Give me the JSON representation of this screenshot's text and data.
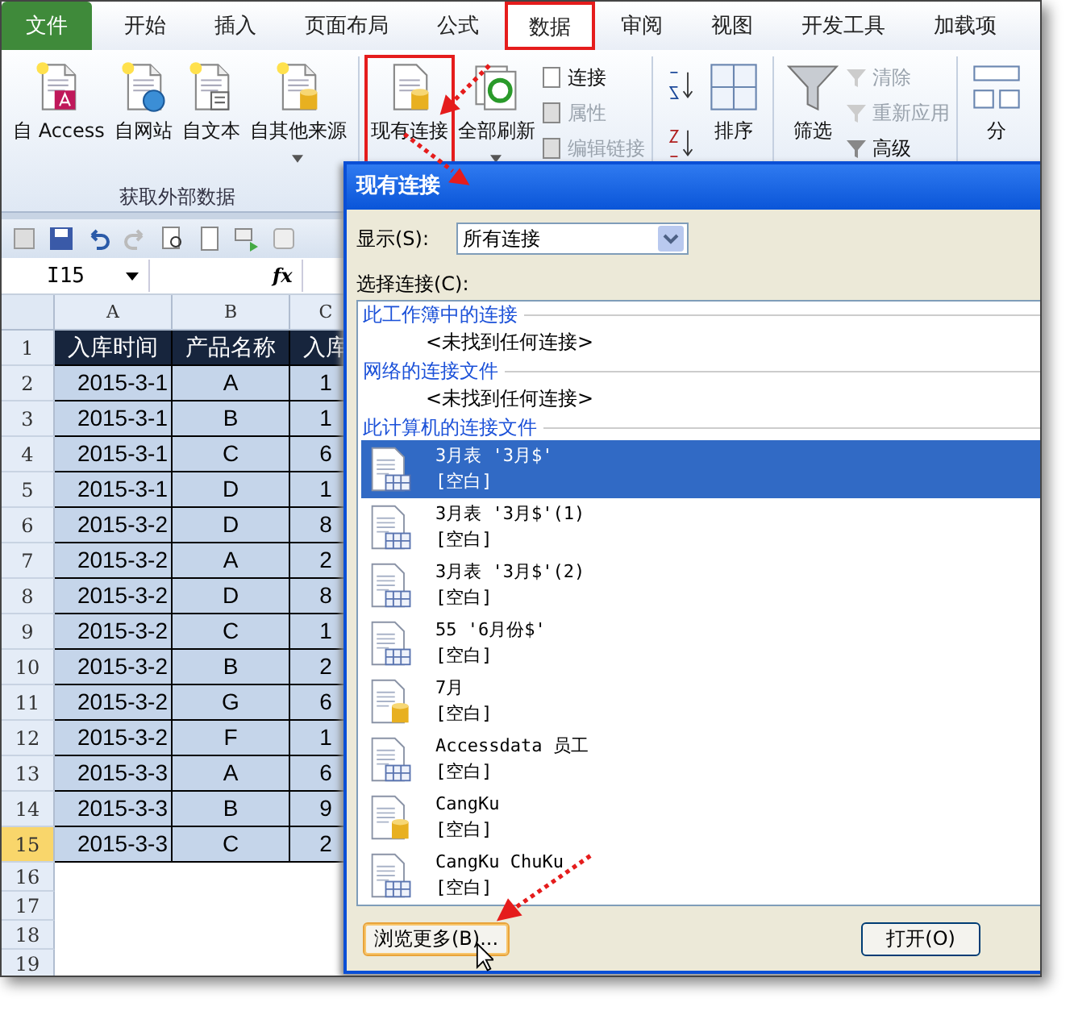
{
  "ribbon": {
    "tabs": [
      {
        "label": "文件",
        "kind": "file",
        "selected": false,
        "annotated": false
      },
      {
        "label": "开始",
        "kind": "tab",
        "selected": false,
        "annotated": false
      },
      {
        "label": "插入",
        "kind": "tab",
        "selected": false,
        "annotated": false
      },
      {
        "label": "页面布局",
        "kind": "tab",
        "selected": false,
        "annotated": false
      },
      {
        "label": "公式",
        "kind": "tab",
        "selected": false,
        "annotated": false
      },
      {
        "label": "数据",
        "kind": "tab",
        "selected": true,
        "annotated": true
      },
      {
        "label": "审阅",
        "kind": "tab",
        "selected": false,
        "annotated": false
      },
      {
        "label": "视图",
        "kind": "tab",
        "selected": false,
        "annotated": false
      },
      {
        "label": "开发工具",
        "kind": "tab",
        "selected": false,
        "annotated": false
      },
      {
        "label": "加载项",
        "kind": "tab",
        "selected": false,
        "annotated": false
      }
    ],
    "external": [
      {
        "label": "自 Access",
        "dropdown": false
      },
      {
        "label": "自网站",
        "dropdown": false
      },
      {
        "label": "自文本",
        "dropdown": false
      },
      {
        "label": "自其他来源",
        "dropdown": true
      }
    ],
    "group_label": "获取外部数据",
    "existing": {
      "label": "现有连接",
      "annotated": true
    },
    "refresh": {
      "label": "全部刷新",
      "dropdown": true
    },
    "connection_small": [
      {
        "label": "连接",
        "disabled": false
      },
      {
        "label": "属性",
        "disabled": true
      },
      {
        "label": "编辑链接",
        "disabled": true
      }
    ],
    "sort": {
      "label": "排序"
    },
    "filter": {
      "label": "筛选"
    },
    "filter_small": [
      {
        "label": "清除",
        "disabled": true
      },
      {
        "label": "重新应用",
        "disabled": true
      },
      {
        "label": "高级",
        "disabled": false
      }
    ],
    "split": {
      "label": "分"
    }
  },
  "formula_bar": {
    "name_box": "I15",
    "fx": "fx"
  },
  "sheet": {
    "columns": [
      "A",
      "B",
      "C"
    ],
    "rows": [
      {
        "num": "1",
        "selected": false,
        "cells": [
          "入库时间",
          "产品名称",
          "入库"
        ]
      },
      {
        "num": "2",
        "selected": false,
        "cells": [
          "2015-3-1",
          "A",
          "1"
        ]
      },
      {
        "num": "3",
        "selected": false,
        "cells": [
          "2015-3-1",
          "B",
          "1"
        ]
      },
      {
        "num": "4",
        "selected": false,
        "cells": [
          "2015-3-1",
          "C",
          "6"
        ]
      },
      {
        "num": "5",
        "selected": false,
        "cells": [
          "2015-3-1",
          "D",
          "1"
        ]
      },
      {
        "num": "6",
        "selected": false,
        "cells": [
          "2015-3-2",
          "D",
          "8"
        ]
      },
      {
        "num": "7",
        "selected": false,
        "cells": [
          "2015-3-2",
          "A",
          "2"
        ]
      },
      {
        "num": "8",
        "selected": false,
        "cells": [
          "2015-3-2",
          "D",
          "8"
        ]
      },
      {
        "num": "9",
        "selected": false,
        "cells": [
          "2015-3-2",
          "C",
          "1"
        ]
      },
      {
        "num": "10",
        "selected": false,
        "cells": [
          "2015-3-2",
          "B",
          "2"
        ]
      },
      {
        "num": "11",
        "selected": false,
        "cells": [
          "2015-3-2",
          "G",
          "6"
        ]
      },
      {
        "num": "12",
        "selected": false,
        "cells": [
          "2015-3-2",
          "F",
          "1"
        ]
      },
      {
        "num": "13",
        "selected": false,
        "cells": [
          "2015-3-3",
          "A",
          "6"
        ]
      },
      {
        "num": "14",
        "selected": false,
        "cells": [
          "2015-3-3",
          "B",
          "9"
        ]
      },
      {
        "num": "15",
        "selected": true,
        "cells": [
          "2015-3-3",
          "C",
          "2"
        ]
      },
      {
        "num": "16",
        "selected": false
      },
      {
        "num": "17",
        "selected": false
      },
      {
        "num": "18",
        "selected": false
      },
      {
        "num": "19",
        "selected": false
      }
    ]
  },
  "dialog": {
    "title": "现有连接",
    "show_label": "显示(S):",
    "show_value": "所有连接",
    "list_label": "选择连接(C):",
    "sections": [
      {
        "title": "此工作簿中的连接",
        "empty_text": "<未找到任何连接>"
      },
      {
        "title": "网络的连接文件",
        "empty_text": "<未找到任何连接>"
      },
      {
        "title": "此计算机的连接文件",
        "items": [
          {
            "name": "3月表 '3月$'",
            "desc": "[空白]",
            "kind": "table",
            "selected": true
          },
          {
            "name": "3月表 '3月$'(1)",
            "desc": "[空白]",
            "kind": "table",
            "selected": false
          },
          {
            "name": "3月表 '3月$'(2)",
            "desc": "[空白]",
            "kind": "table",
            "selected": false
          },
          {
            "name": "55 '6月份$'",
            "desc": "[空白]",
            "kind": "table",
            "selected": false
          },
          {
            "name": "7月",
            "desc": "[空白]",
            "kind": "database",
            "selected": false
          },
          {
            "name": "Accessdata 员工",
            "desc": "[空白]",
            "kind": "table",
            "selected": false
          },
          {
            "name": "CangKu",
            "desc": "[空白]",
            "kind": "database",
            "selected": false
          },
          {
            "name": "CangKu ChuKu",
            "desc": "[空白]",
            "kind": "table",
            "selected": false
          }
        ]
      }
    ],
    "buttons": [
      {
        "label": "浏览更多(B)...",
        "kind": "browse"
      },
      {
        "label": "打开(O)",
        "kind": "open"
      }
    ]
  }
}
